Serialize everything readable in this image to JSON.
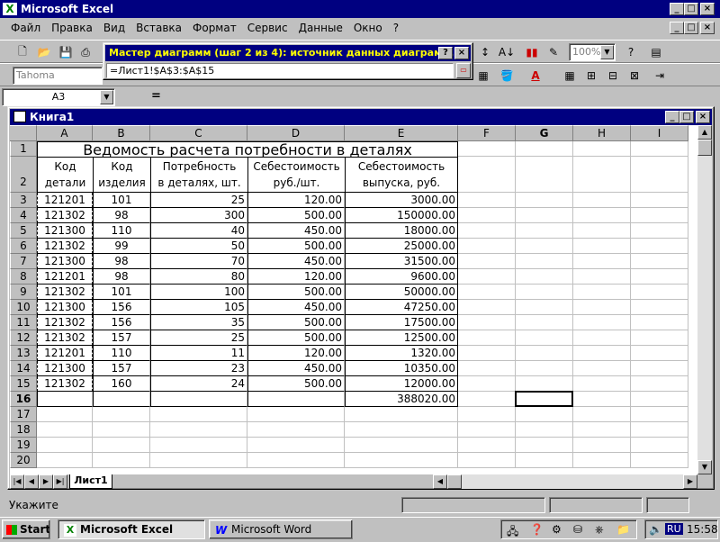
{
  "app": {
    "title": "Microsoft Excel",
    "menu": [
      "Файл",
      "Правка",
      "Вид",
      "Вставка",
      "Формат",
      "Сервис",
      "Данные",
      "Окно",
      "?"
    ]
  },
  "toolbar": {
    "font_name": "Tahoma",
    "zoom": "100%"
  },
  "wizard": {
    "title": "Мастер диаграмм (шаг 2 из 4): источник данных диаграмм...",
    "range_value": "=Лист1!$A$3:$A$15",
    "help_label": "?",
    "close_label": "×"
  },
  "formula_bar": {
    "name_box": "A3",
    "equals": "="
  },
  "workbook": {
    "title": "Книга1",
    "columns": [
      "A",
      "B",
      "C",
      "D",
      "E",
      "F",
      "G",
      "H",
      "I"
    ],
    "rows": [
      "1",
      "2",
      "3",
      "4",
      "5",
      "6",
      "7",
      "8",
      "9",
      "10",
      "11",
      "12",
      "13",
      "14",
      "15",
      "16",
      "17",
      "18",
      "19",
      "20"
    ],
    "sheet_title": "Ведомость расчета потребности в деталях",
    "headers": {
      "a": [
        "Код",
        "детали"
      ],
      "b": [
        "Код",
        "изделия"
      ],
      "c": [
        "Потребность",
        "в деталях, шт."
      ],
      "d": [
        "Себестоимость",
        "руб./шт."
      ],
      "e": [
        "Себестоимость",
        "выпуска, руб."
      ]
    },
    "data": [
      [
        "121201",
        "101",
        "25",
        "120.00",
        "3000.00"
      ],
      [
        "121302",
        "98",
        "300",
        "500.00",
        "150000.00"
      ],
      [
        "121300",
        "110",
        "40",
        "450.00",
        "18000.00"
      ],
      [
        "121302",
        "99",
        "50",
        "500.00",
        "25000.00"
      ],
      [
        "121300",
        "98",
        "70",
        "450.00",
        "31500.00"
      ],
      [
        "121201",
        "98",
        "80",
        "120.00",
        "9600.00"
      ],
      [
        "121302",
        "101",
        "100",
        "500.00",
        "50000.00"
      ],
      [
        "121300",
        "156",
        "105",
        "450.00",
        "47250.00"
      ],
      [
        "121302",
        "156",
        "35",
        "500.00",
        "17500.00"
      ],
      [
        "121302",
        "157",
        "25",
        "500.00",
        "12500.00"
      ],
      [
        "121201",
        "110",
        "11",
        "120.00",
        "1320.00"
      ],
      [
        "121300",
        "157",
        "23",
        "450.00",
        "10350.00"
      ],
      [
        "121302",
        "160",
        "24",
        "500.00",
        "12000.00"
      ]
    ],
    "total": "388020.00",
    "sheet_tab": "Лист1"
  },
  "status": {
    "text": "Укажите"
  },
  "taskbar": {
    "start": "Start",
    "tasks": [
      "Microsoft Excel",
      "Microsoft Word"
    ],
    "lang": "RU",
    "clock": "15:58"
  },
  "colors": {
    "title_bg": "#000080",
    "face": "#c0c0c0",
    "wizard_title_fg": "#ffff00"
  }
}
